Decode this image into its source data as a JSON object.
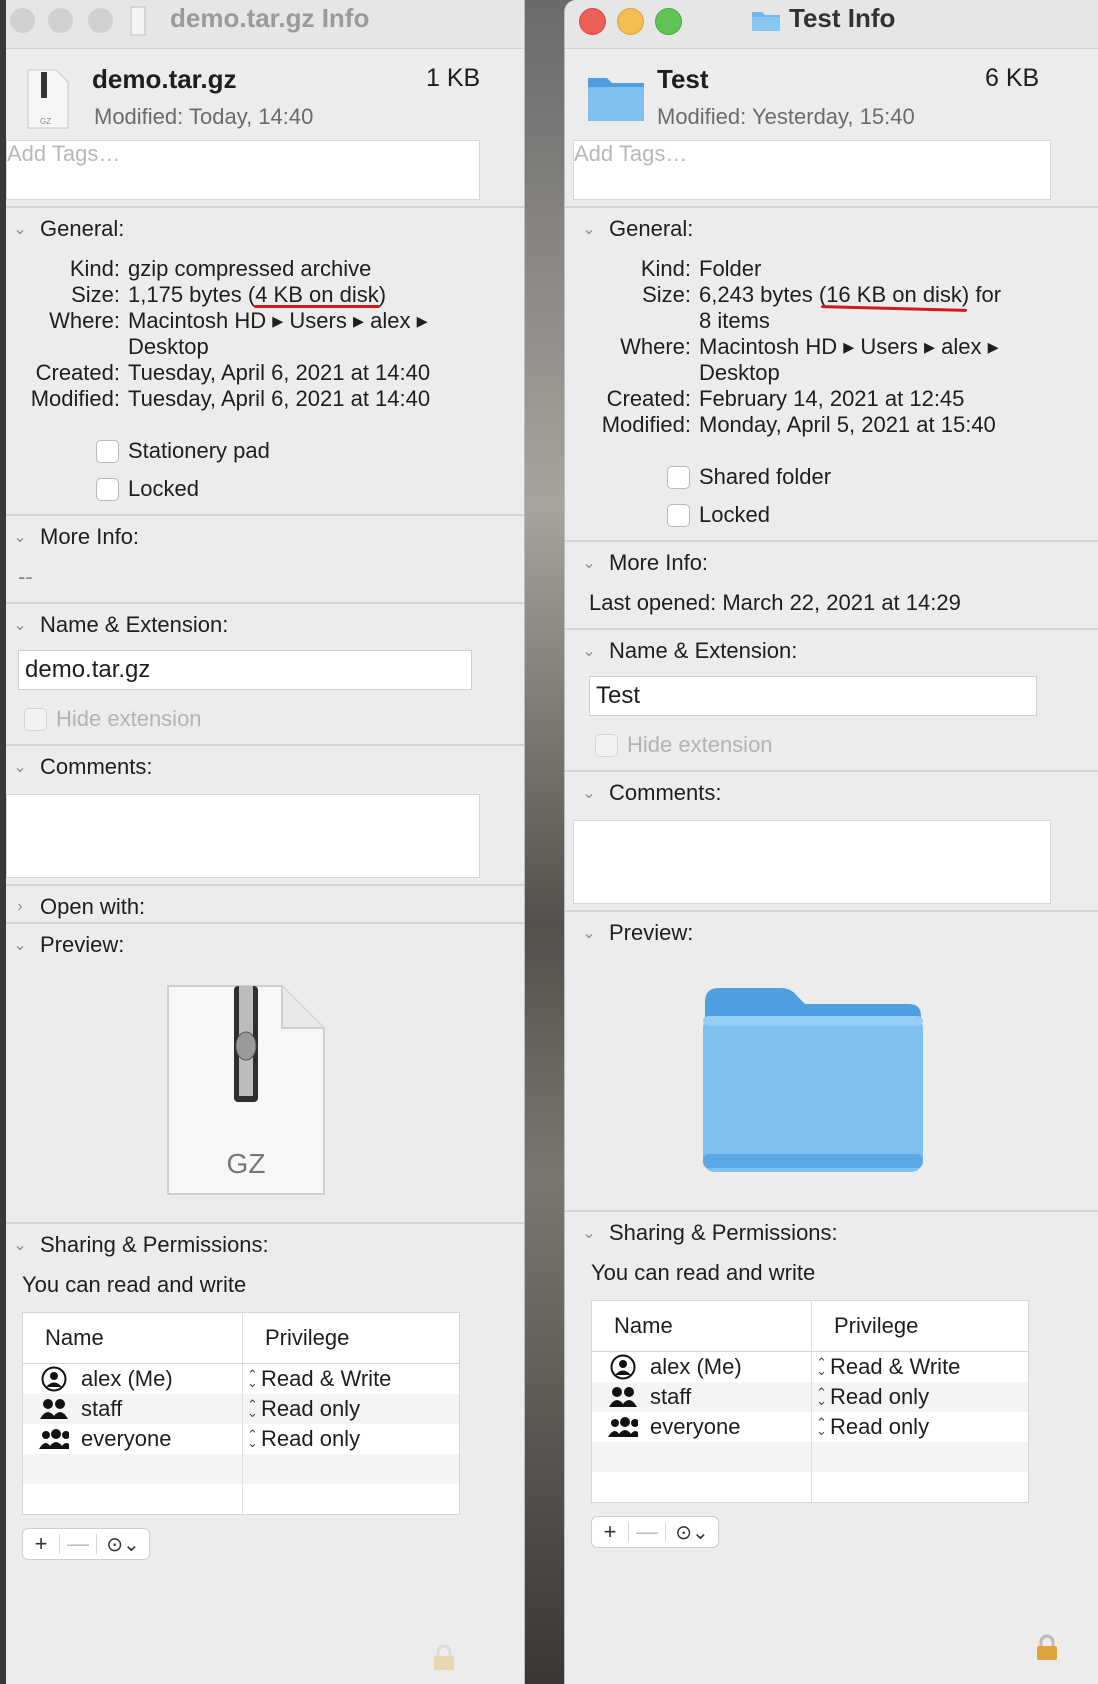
{
  "left": {
    "title": "demo.tar.gz Info",
    "file_name": "demo.tar.gz",
    "file_size": "1 KB",
    "modified_label": "Modified:",
    "modified_value": "Today, 14:40",
    "tags_placeholder": "Add Tags…",
    "general_label": "General:",
    "kind_label": "Kind:",
    "kind_value": "gzip compressed archive",
    "size_label": "Size:",
    "size_value": "1,175 bytes (4 KB on disk)",
    "where_label": "Where:",
    "where_value_1": "Macintosh HD ▸ Users ▸ alex ▸",
    "where_value_2": "Desktop",
    "created_label": "Created:",
    "created_value": "Tuesday, April 6, 2021 at 14:40",
    "modified2_label": "Modified:",
    "modified2_value": "Tuesday, April 6, 2021 at 14:40",
    "checkbox_1": "Stationery pad",
    "checkbox_2": "Locked",
    "more_info_label": "More Info:",
    "more_info_value": "--",
    "name_ext_label": "Name & Extension:",
    "name_value": "demo.tar.gz",
    "hide_ext": "Hide extension",
    "comments_label": "Comments:",
    "open_with_label": "Open with:",
    "preview_label": "Preview:",
    "preview_icon_text": "GZ",
    "sharing_label": "Sharing & Permissions:",
    "sharing_text": "You can read and write",
    "col_name": "Name",
    "col_priv": "Privilege",
    "users": [
      {
        "name": "alex (Me)",
        "priv": "Read & Write",
        "icon": "user-icon"
      },
      {
        "name": "staff",
        "priv": "Read only",
        "icon": "group-icon"
      },
      {
        "name": "everyone",
        "priv": "Read only",
        "icon": "everyone-icon"
      }
    ]
  },
  "right": {
    "title": "Test Info",
    "file_name": "Test",
    "file_size": "6 KB",
    "modified_label": "Modified:",
    "modified_value": "Yesterday, 15:40",
    "tags_placeholder": "Add Tags…",
    "general_label": "General:",
    "kind_label": "Kind:",
    "kind_value": "Folder",
    "size_label": "Size:",
    "size_value": "6,243 bytes (16 KB on disk) for",
    "size_value_2": "8 items",
    "where_label": "Where:",
    "where_value_1": "Macintosh HD ▸ Users ▸ alex ▸",
    "where_value_2": "Desktop",
    "created_label": "Created:",
    "created_value": "February 14, 2021 at 12:45",
    "modified2_label": "Modified:",
    "modified2_value": "Monday, April 5, 2021 at 15:40",
    "checkbox_1": "Shared folder",
    "checkbox_2": "Locked",
    "more_info_label": "More Info:",
    "last_opened": "Last opened: March 22, 2021 at 14:29",
    "name_ext_label": "Name & Extension:",
    "name_value": "Test",
    "hide_ext": "Hide extension",
    "comments_label": "Comments:",
    "preview_label": "Preview:",
    "sharing_label": "Sharing & Permissions:",
    "sharing_text": "You can read and write",
    "col_name": "Name",
    "col_priv": "Privilege",
    "users": [
      {
        "name": "alex (Me)",
        "priv": "Read & Write",
        "icon": "user-icon"
      },
      {
        "name": "staff",
        "priv": "Read only",
        "icon": "group-icon"
      },
      {
        "name": "everyone",
        "priv": "Read only",
        "icon": "everyone-icon"
      }
    ]
  },
  "colors": {
    "close": "#ec5f57",
    "minimize": "#f4bd4f",
    "zoom": "#5fc454",
    "folder_blue": "#6db8ec",
    "annotation_red": "#cc1b1b"
  },
  "toolbar": {
    "add": "+",
    "remove": "—",
    "action": "⊙⌄"
  }
}
